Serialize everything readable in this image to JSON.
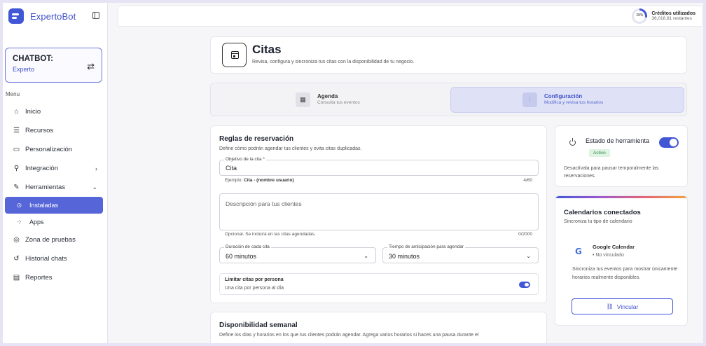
{
  "app": {
    "brand_name": "ExpertoBot"
  },
  "sidebar": {
    "chatbot_title": "CHATBOT:",
    "chatbot_name": "Experto",
    "menu_label": "Menu",
    "items": [
      {
        "label": "Inicio",
        "icon": "home-icon"
      },
      {
        "label": "Recursos",
        "icon": "resources-icon"
      },
      {
        "label": "Personalización",
        "icon": "chat-icon"
      },
      {
        "label": "Integración",
        "icon": "plug-icon"
      },
      {
        "label": "Herramientas",
        "icon": "tools-icon"
      },
      {
        "label": "Instaladas",
        "icon": "check-circle-icon"
      },
      {
        "label": "Apps",
        "icon": "apps-icon"
      },
      {
        "label": "Zona de pruebas",
        "icon": "test-icon"
      },
      {
        "label": "Historial chats",
        "icon": "history-icon"
      },
      {
        "label": "Reportes",
        "icon": "report-icon"
      }
    ]
  },
  "credits": {
    "percent_label": "28%",
    "percent_value": 0.28,
    "title": "Créditos utilizados",
    "remaining": "36,018.81 restantes"
  },
  "header": {
    "title": "Citas",
    "subtitle": "Revisa, configura y sincroniza tus citas con la disponibilidad de tu negocio."
  },
  "tabs": [
    {
      "label": "Agenda",
      "sub": "Consulta tus eventos"
    },
    {
      "label": "Configuración",
      "sub": "Modifica y revisa tus horarios"
    }
  ],
  "rules": {
    "title": "Reglas de reservación",
    "subtitle": "Define cómo podrán agendar tus clientes y evita citas duplicadas.",
    "objective_label": "Objetivo de la cita *",
    "objective_value": "Cita",
    "objective_hint_prefix": "Ejemplo: ",
    "objective_hint_example": "Cita - (nombre usuario)",
    "objective_count": "4/60",
    "description_placeholder": "Descripción para tus clientes",
    "description_hint": "Opcional. Se incluirá en las citas agendadas.",
    "description_count": "0/2000",
    "duration_label": "Duración de cada cita",
    "duration_value": "60 minutos",
    "advance_label": "Tiempo de anticipación para agendar",
    "advance_value": "30 minutos",
    "limit_title": "Limitar citas por persona",
    "limit_sub": "Una cita por persona al día",
    "limit_enabled": true
  },
  "availability": {
    "title": "Disponibilidad semanal",
    "subtitle": "Define los días y horarios en los que tus clientes podrán agendar. Agrega varios horarios si haces una pausa durante el"
  },
  "status": {
    "title": "Estado de herramienta",
    "badge": "Activo",
    "enabled": true,
    "description": "Desactívala para pausar temporalmente las reservaciones."
  },
  "calendars": {
    "title": "Calendarios conectados",
    "subtitle": "Sincroniza tu tipo de calendario",
    "provider_name": "Google Calendar",
    "provider_status": "• No vinculado",
    "description": "Sincroniza tus eventos para mostrar únicamente horarios realmente disponibles.",
    "link_button": "Vincular"
  }
}
